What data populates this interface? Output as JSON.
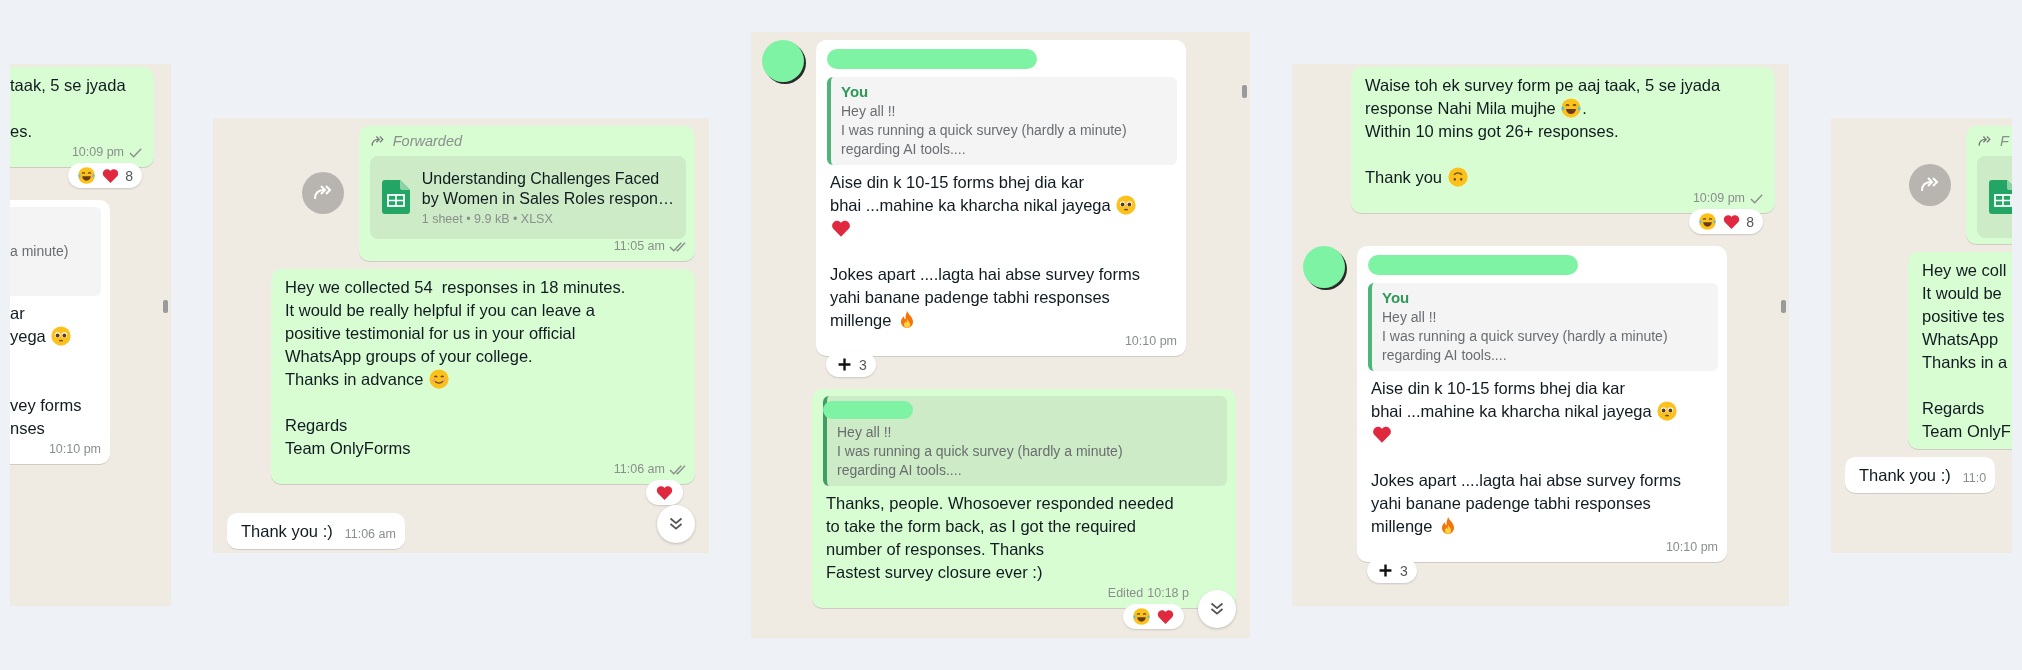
{
  "panels": [
    {
      "kind": "clip-left",
      "scrollbar": true,
      "scroll_down_button": false,
      "messages": [
        {
          "kind": "out",
          "body": [
            {
              "kind": "text",
              "text": "taak, 5 se jyada\n\nes."
            }
          ],
          "time": "10:09 pm",
          "double_ticks": false,
          "reactions": {
            "items": [
              {
                "kind": "laugh"
              },
              {
                "kind": "heart"
              }
            ],
            "count": "8"
          }
        },
        {
          "kind": "in",
          "redacted_sender": false,
          "quote": {
            "text": "a minute)"
          },
          "body": [
            {
              "kind": "text",
              "text": "ar\nyega "
            },
            {
              "kind": "pleading"
            },
            {
              "kind": "text",
              "text": "\n\n\nvey forms\nnses"
            }
          ],
          "time": "10:10 pm"
        }
      ]
    },
    {
      "kind": "full",
      "scrollbar": false,
      "scroll_down_button": true,
      "messages": [
        {
          "kind": "out",
          "forward_button": true,
          "forwarded": "Forwarded",
          "file": {
            "kind": "sheet",
            "name": "Understanding Challenges Faced\nby Women in Sales Roles respon…",
            "meta": "1 sheet • 9.9 kB • XLSX"
          },
          "time": "11:05 am",
          "double_ticks": true
        },
        {
          "kind": "out",
          "body": [
            {
              "kind": "text",
              "text": "Hey we collected 54  responses in 18 minutes.\nIt would be really helpful if you can leave a\npositive testimonial for us in your official\nWhatsApp groups of your college.\nThanks in advance "
            },
            {
              "kind": "smile"
            },
            {
              "kind": "text",
              "text": "\n\nRegards\nTeam OnlyForms"
            }
          ],
          "time": "11:06 am",
          "double_ticks": true,
          "reactions": {
            "items": [
              {
                "kind": "heart"
              }
            ]
          }
        },
        {
          "kind": "in",
          "body": [
            {
              "kind": "text",
              "text": "Thank you :)"
            }
          ],
          "time": "11:06 am"
        }
      ]
    },
    {
      "kind": "full",
      "scrollbar": true,
      "scroll_down_button": true,
      "messages": [
        {
          "kind": "in",
          "redacted_sender": true,
          "quote": {
            "author": "You",
            "text": "Hey all !!\nI was running a quick survey (hardly a minute)\nregarding AI tools...."
          },
          "body": [
            {
              "kind": "text",
              "text": "Aise din k 10-15 forms bhej dia kar\nbhai ...mahine ka kharcha nikal jayega "
            },
            {
              "kind": "pleading"
            },
            {
              "kind": "break"
            },
            {
              "kind": "heart"
            },
            {
              "kind": "text",
              "text": "\n\nJokes apart ....lagta hai abse survey forms\nyahi banane padenge tabhi responses\nmillenge "
            },
            {
              "kind": "fire"
            }
          ],
          "time": "10:10 pm",
          "reactions": {
            "items": [
              {
                "kind": "plus"
              }
            ],
            "count": "3"
          }
        },
        {
          "kind": "out",
          "quote": {
            "redacted": true,
            "text": "Hey all !!\nI was running a quick survey (hardly a minute)\nregarding AI tools...."
          },
          "body": [
            {
              "kind": "text",
              "text": "Thanks, people. Whosoever responded needed\nto take the form back, as I got the required\nnumber of responses. Thanks\nFastest survey closure ever :)"
            }
          ],
          "edited": "Edited",
          "time": "10:18 p",
          "reactions": {
            "items": [
              {
                "kind": "laugh"
              },
              {
                "kind": "heart"
              }
            ]
          }
        }
      ]
    },
    {
      "kind": "full",
      "scrollbar": true,
      "scroll_down_button": false,
      "messages": [
        {
          "kind": "out",
          "body": [
            {
              "kind": "text",
              "text": "Waise toh ek survey form pe aaj taak, 5 se jyada\nresponse Nahi Mila mujhe "
            },
            {
              "kind": "laugh"
            },
            {
              "kind": "text",
              "text": ".\nWithin 10 mins got 26+ responses.\n\nThank you "
            },
            {
              "kind": "upside"
            }
          ],
          "time": "10:09 pm",
          "double_ticks": false,
          "reactions": {
            "items": [
              {
                "kind": "laugh"
              },
              {
                "kind": "heart"
              }
            ],
            "count": "8"
          }
        },
        {
          "kind": "in",
          "redacted_sender": true,
          "quote": {
            "author": "You",
            "text": "Hey all !!\nI was running a quick survey (hardly a minute)\nregarding AI tools...."
          },
          "body": [
            {
              "kind": "text",
              "text": "Aise din k 10-15 forms bhej dia kar\nbhai ...mahine ka kharcha nikal jayega "
            },
            {
              "kind": "pleading"
            },
            {
              "kind": "break"
            },
            {
              "kind": "heart"
            },
            {
              "kind": "text",
              "text": "\n\nJokes apart ....lagta hai abse survey forms\nyahi banane padenge tabhi responses\nmillenge "
            },
            {
              "kind": "fire"
            }
          ],
          "time": "10:10 pm",
          "reactions": {
            "items": [
              {
                "kind": "plus"
              }
            ],
            "count": "3"
          }
        }
      ]
    },
    {
      "kind": "clip-right",
      "scrollbar": false,
      "scroll_down_button": false,
      "messages": [
        {
          "kind": "out",
          "forward_button": true,
          "forwarded": "F",
          "file": {
            "kind": "sheet"
          }
        },
        {
          "kind": "out",
          "body": [
            {
              "kind": "text",
              "text": "Hey we coll\nIt would be\npositive tes\nWhatsApp\nThanks in a\n\nRegards\nTeam OnlyF"
            }
          ]
        },
        {
          "kind": "in",
          "body": [
            {
              "kind": "text",
              "text": "Thank you :)"
            }
          ],
          "time": "11:0"
        }
      ]
    }
  ]
}
